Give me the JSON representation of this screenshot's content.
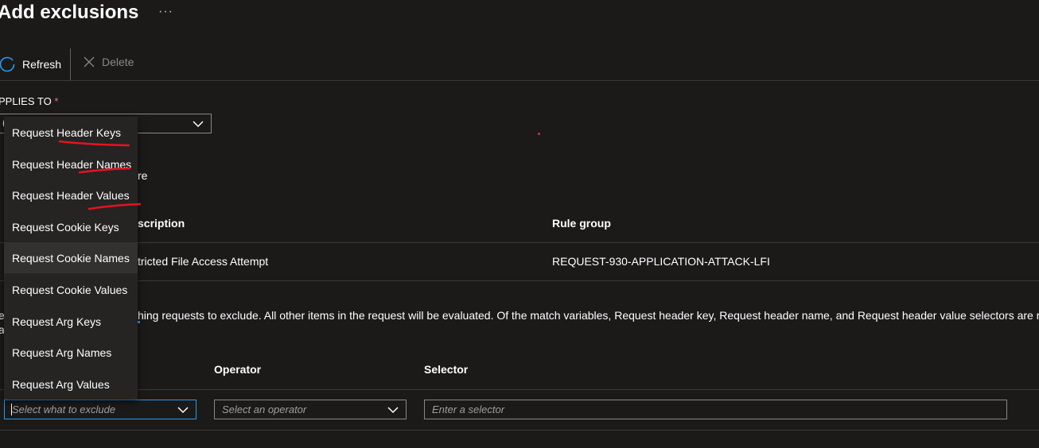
{
  "page": {
    "title": "Add exclusions",
    "more_label": "···"
  },
  "toolbar": {
    "refresh_label": "Refresh",
    "delete_label": "Delete"
  },
  "applies_to": {
    "label": "PPLIES TO",
    "required_mark": "*",
    "value_fragment": "("
  },
  "behind_dropdown": {
    "text_fragment": "re"
  },
  "rules_table": {
    "headers": [
      "scription",
      "Rule group"
    ],
    "rows": [
      [
        "tricted File Access Attempt",
        "REQUEST-930-APPLICATION-ATTACK-LFI"
      ]
    ]
  },
  "description": {
    "text_start": "e",
    "text_main": "hing requests to exclude. All other items in the request will be evaluated. Of the match variables, Request header key, Request header name, and Request header value selectors are r",
    "second_line_fragment": "a"
  },
  "exclusion_table": {
    "headers": [
      "Operator",
      "Selector"
    ],
    "match_variable_placeholder": "Select what to exclude",
    "operator_placeholder": "Select an operator",
    "selector_placeholder": "Enter a selector"
  },
  "dropdown": {
    "options": [
      "Request Header Keys",
      "Request Header Names",
      "Request Header Values",
      "Request Cookie Keys",
      "Request Cookie Names",
      "Request Cookie Values",
      "Request Arg Keys",
      "Request Arg Names",
      "Request Arg Values"
    ],
    "hovered_option": "Request Cookie Names"
  },
  "colors": {
    "background": "#1b1a19",
    "accent": "#2899f5",
    "annotation_red": "#e81123",
    "dropdown_bg": "#252423"
  },
  "icons": {
    "refresh": "refresh-icon",
    "delete": "close-x-icon",
    "more": "ellipsis-icon",
    "chevron": "chevron-down-icon"
  }
}
